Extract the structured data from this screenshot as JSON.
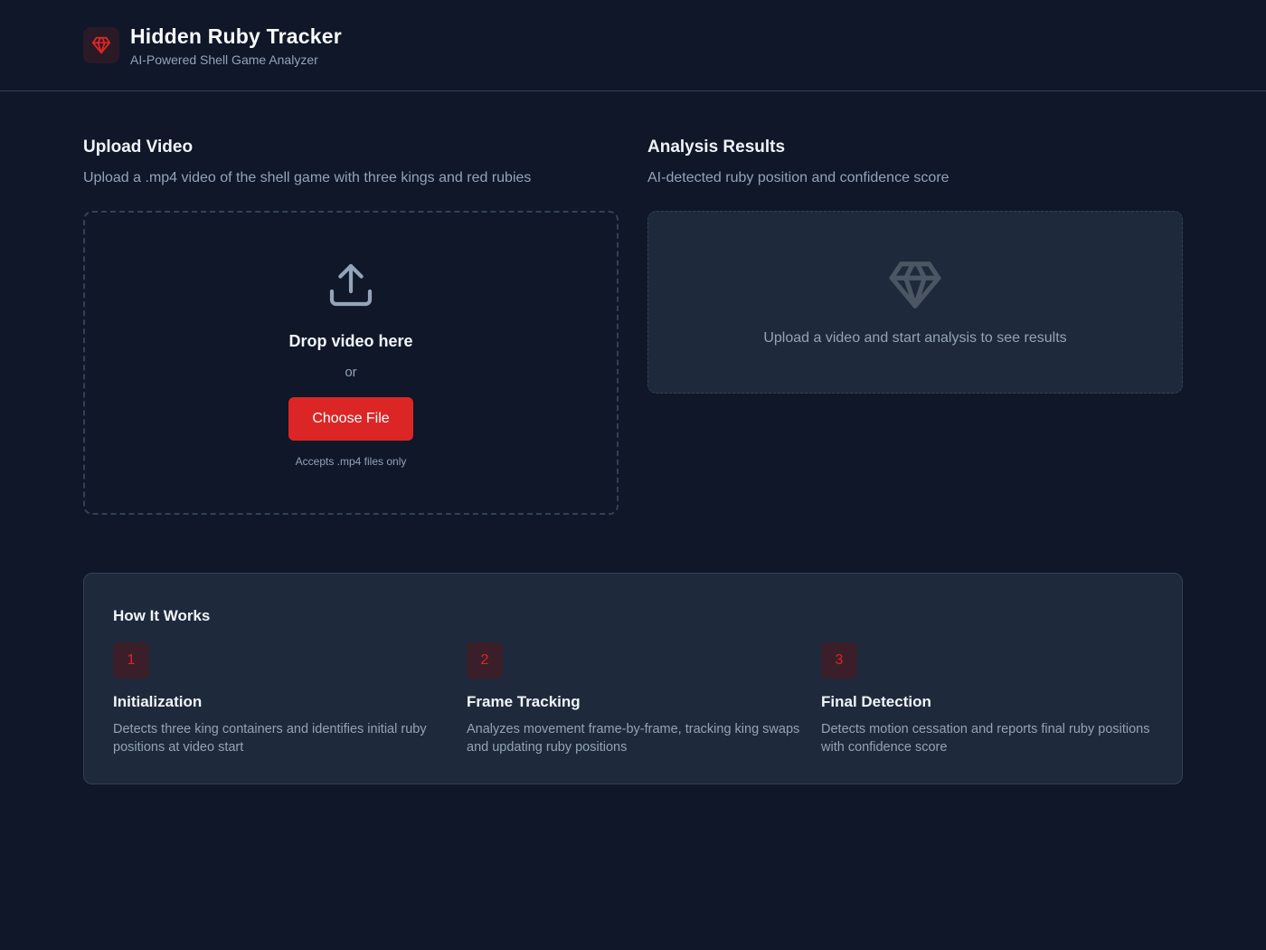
{
  "header": {
    "title": "Hidden Ruby Tracker",
    "subtitle": "AI-Powered Shell Game Analyzer",
    "logo_icon": "gem-icon"
  },
  "upload": {
    "title": "Upload Video",
    "description": "Upload a .mp4 video of the shell game with three kings and red rubies",
    "drop_title": "Drop video here",
    "or_text": "or",
    "button_label": "Choose File",
    "accept_note": "Accepts .mp4 files only",
    "icon": "upload-icon"
  },
  "results": {
    "title": "Analysis Results",
    "description": "AI-detected ruby position and confidence score",
    "placeholder": "Upload a video and start analysis to see results",
    "icon": "gem-icon"
  },
  "how_it_works": {
    "title": "How It Works",
    "steps": [
      {
        "number": "1",
        "title": "Initialization",
        "description": "Detects three king containers and identifies initial ruby positions at video start"
      },
      {
        "number": "2",
        "title": "Frame Tracking",
        "description": "Analyzes movement frame-by-frame, tracking king swaps and updating ruby positions"
      },
      {
        "number": "3",
        "title": "Final Detection",
        "description": "Detects motion cessation and reports final ruby positions with confidence score"
      }
    ]
  },
  "colors": {
    "background": "#0f1729",
    "card": "#1e293b",
    "accent": "#dc2626",
    "muted_text": "#94a3b8",
    "border": "#334155"
  }
}
